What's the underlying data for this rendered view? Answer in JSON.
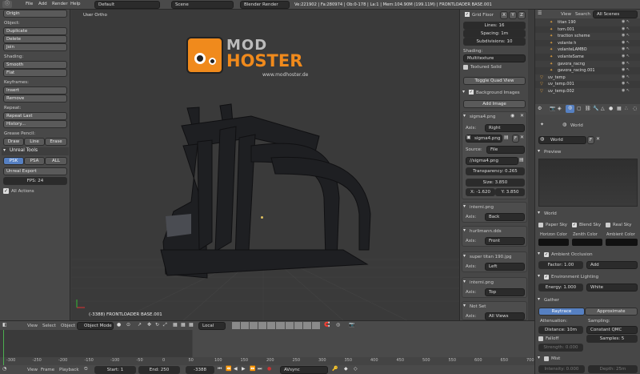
{
  "topbar": {
    "menus": [
      "File",
      "Add",
      "Render",
      "Help"
    ],
    "layout": "Default",
    "scene": "Scene",
    "engine": "Blender Render",
    "stats": "Ve:221902 | Fa:280974 | Ob:0-178 | La:1 | Mem:104.90M (199.11M) | FRONTLOADER BASE.001"
  },
  "toolshelf": {
    "origin": "Origin",
    "object_label": "Object:",
    "object_buttons": [
      "Duplicate",
      "Delete",
      "Join"
    ],
    "shading_label": "Shading:",
    "shading_buttons": [
      "Smooth",
      "Flat"
    ],
    "keyframes_label": "Keyframes:",
    "keyframe_buttons": [
      "Insert",
      "Remove"
    ],
    "repeat_label": "Repeat:",
    "repeat_buttons": [
      "Repeat Last",
      "History..."
    ],
    "grease_label": "Grease Pencil:",
    "grease_buttons": [
      "Draw",
      "Line",
      "Erase"
    ],
    "unreal_header": "Unreal Tools",
    "unreal_formats": [
      "PSK",
      "PSA",
      "ALL"
    ],
    "unreal_export": "Unreal Export",
    "fps": "FPS: 24",
    "all_actions": "All Actions"
  },
  "viewport": {
    "label": "User Ortho",
    "object_info": "(-3388) FRONTLOADER BASE.001",
    "logo_mod": "MOD",
    "logo_hoster": "HOSTER",
    "logo_url": "www.modhoster.de"
  },
  "view_header": {
    "items": [
      "View",
      "Select",
      "Object"
    ],
    "mode": "Object Mode",
    "pivot": "Local"
  },
  "properties_n": {
    "grid_floor": "Grid Floor",
    "axes": [
      "X",
      "Y",
      "Z"
    ],
    "lines": "Lines: 16",
    "spacing": "Spacing: 1m",
    "subdivisions": "Subdivisions: 10",
    "shading_label": "Shading:",
    "shading_value": "Multitexture",
    "textured_solid": "Textured Solid",
    "toggle_quad": "Toggle Quad View",
    "bg_images": "Background Images",
    "add_image": "Add Image",
    "images": [
      {
        "name": "sigma4.png",
        "axis": "Right"
      },
      {
        "name": "interni.png",
        "axis": "Back"
      },
      {
        "name": "hurlimann.dds",
        "axis": "Front"
      },
      {
        "name": "super titan 190.jpg",
        "axis": "Left"
      },
      {
        "name": "interni.png",
        "axis": "Top"
      },
      {
        "name": "Not Set",
        "axis": "All Views"
      }
    ],
    "axis_label": "Axis:",
    "img_file": "sigma4.png",
    "source_label": "Source:",
    "source_value": "File",
    "path": "//sigma4.png",
    "transparency": "Transparency: 0.265",
    "size": "Size: 3.850",
    "x": "X: -1.620",
    "y": "Y: 3.850"
  },
  "outliner": {
    "header": [
      "View",
      "Search"
    ],
    "scenes": "All Scenes",
    "items": [
      "titan 190",
      "tom.001",
      "traction scheme",
      "volante h",
      "volanteLAMBO",
      "volanteSame",
      "gavora_racng",
      "gavora_racing.001",
      "uv_temp",
      "uv_temp.001",
      "uv_temp.002"
    ]
  },
  "world_props": {
    "world_name": "World",
    "world_field": "World",
    "f_label": "F",
    "preview": "Preview",
    "world_header": "World",
    "sky_options": [
      "Paper Sky",
      "Blend Sky",
      "Real Sky"
    ],
    "colors": [
      "Horizon Color",
      "Zenith Color",
      "Ambient Color"
    ],
    "ao": "Ambient Occlusion",
    "factor": "Factor: 1.00",
    "ao_mode": "Add",
    "env": "Environment Lighting",
    "energy": "Energy: 1.000",
    "env_color": "White",
    "gather": "Gather",
    "gather_modes": [
      "Raytrace",
      "Approximate"
    ],
    "attenuation": "Attenuation:",
    "distance": "Distance: 10m",
    "falloff": "Falloff",
    "strength": "Strength: 0.000",
    "sampling": "Sampling:",
    "sampling_value": "Constant QMC",
    "samples": "Samples: 5",
    "mist": "Mist",
    "intensity": "Intensity: 0.000",
    "depth": "Depth: 25m"
  },
  "timeline": {
    "ticks": [
      "-300",
      "-250",
      "-200",
      "-150",
      "-100",
      "-50",
      "0",
      "50",
      "100",
      "150",
      "200",
      "250",
      "300",
      "350",
      "400",
      "450",
      "500",
      "550",
      "600",
      "650",
      "700"
    ],
    "menus": [
      "View",
      "Frame",
      "Playback"
    ],
    "start": "Start: 1",
    "end": "End: 250",
    "current": "-3388",
    "sync": "AVsync"
  },
  "colors": {
    "accent": "#5680c2",
    "logo_orange": "#f08a1c",
    "viewport_bg": "#3a3a3a"
  }
}
